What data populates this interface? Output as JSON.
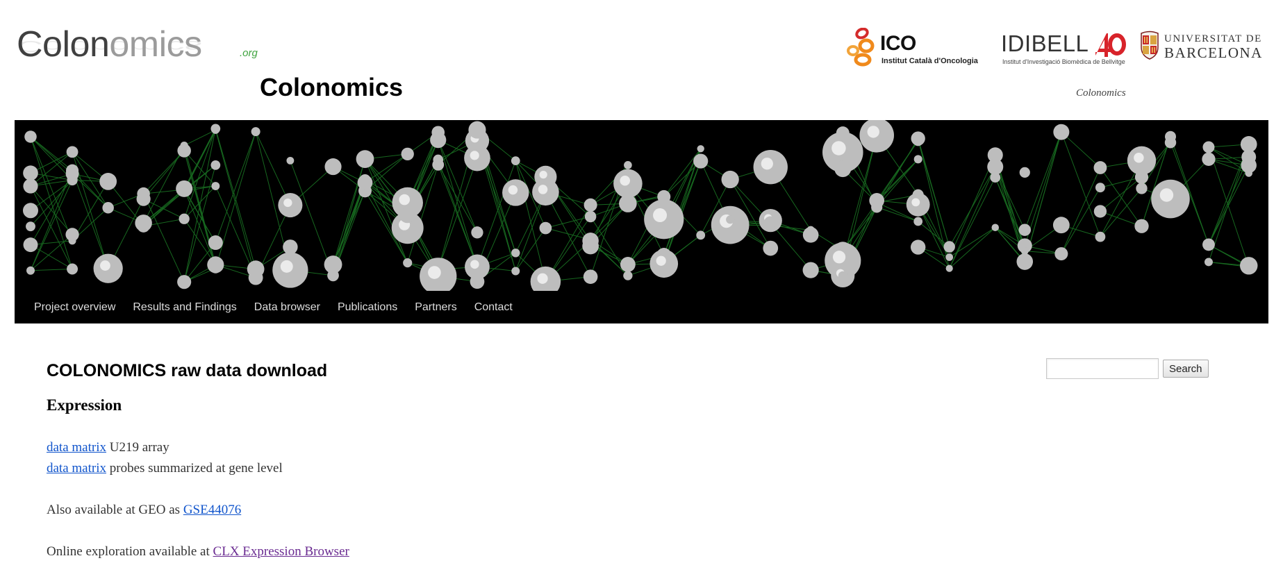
{
  "header": {
    "logo_dark_1": "Colon",
    "logo_light": "omics",
    "logo_tld": ".org",
    "site_title": "Colonomics",
    "tagline": "Colonomics",
    "partners": {
      "ico_name": "ICO",
      "ico_sub": "Institut Català d'Oncologia",
      "idibell_name": "IDIBELL",
      "idibell_sub": "Institut d'Investigació Biomèdica de Bellvitge",
      "ub_line1": "UNIVERSITAT DE",
      "ub_line2": "BARCELONA"
    }
  },
  "nav": {
    "items": [
      {
        "label": "Project overview"
      },
      {
        "label": "Results and Findings"
      },
      {
        "label": "Data browser"
      },
      {
        "label": "Publications"
      },
      {
        "label": "Partners"
      },
      {
        "label": "Contact"
      }
    ]
  },
  "search": {
    "value": "",
    "button_label": "Search"
  },
  "content": {
    "page_title": "COLONOMICS raw data download",
    "section_title": "Expression",
    "lines": [
      {
        "link": "data matrix",
        "text": " U219 array"
      },
      {
        "link": "data matrix",
        "text": " probes summarized at gene level"
      }
    ],
    "geo_prefix": "Also available at GEO as ",
    "geo_link": "GSE44076",
    "browser_prefix": "Online exploration available at ",
    "browser_link": "CLX Expression Browser"
  },
  "colors": {
    "link": "#1155cc",
    "visited_link": "#6a2b91",
    "nav_background": "#000000",
    "nav_text": "#dddddd",
    "network_edges": "#1f8a2a",
    "network_nodes": "#bdbdbd"
  }
}
